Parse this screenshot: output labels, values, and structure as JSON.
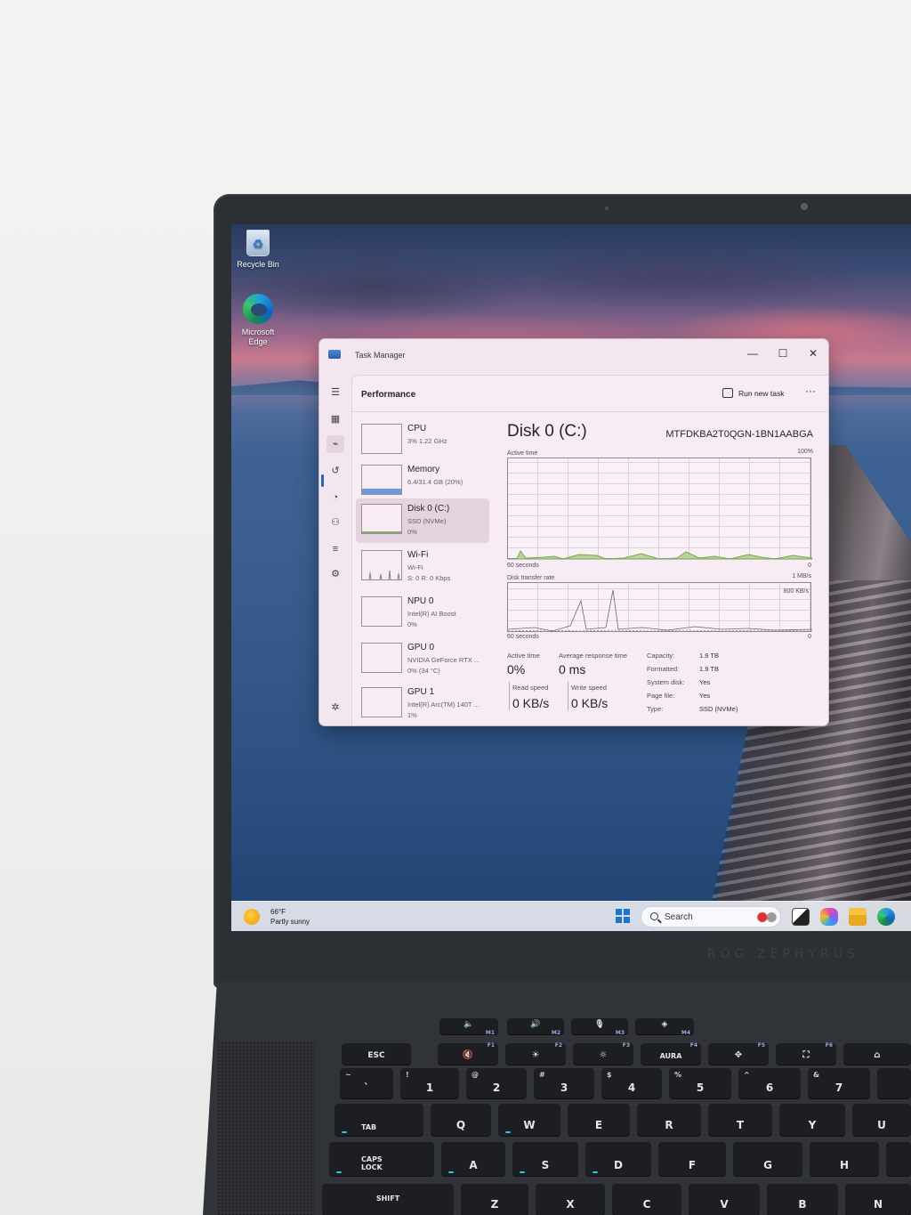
{
  "desktop": {
    "icons": [
      {
        "label": "Recycle Bin",
        "icon": "recycle-bin-icon"
      },
      {
        "label": "Microsoft Edge",
        "icon": "edge-icon"
      }
    ]
  },
  "window": {
    "title": "Task Manager",
    "controls": {
      "minimize": "—",
      "maximize": "☐",
      "close": "✕"
    }
  },
  "header": {
    "section_title": "Performance",
    "run_new_task": "Run new task",
    "more": "···"
  },
  "rail": {
    "icons": [
      "hamburger-icon",
      "processes-icon",
      "performance-icon",
      "app-history-icon",
      "startup-icon",
      "users-icon",
      "details-icon",
      "services-icon",
      "settings-icon"
    ]
  },
  "devices": [
    {
      "name": "CPU",
      "line1": "3%  1.22 GHz",
      "line2": ""
    },
    {
      "name": "Memory",
      "line1": "6.4/31.4 GB (20%)",
      "line2": ""
    },
    {
      "name": "Disk 0 (C:)",
      "line1": "SSD (NVMe)",
      "line2": "0%"
    },
    {
      "name": "Wi-Fi",
      "line1": "Wi-Fi",
      "line2": "S: 0  R: 0 Kbps"
    },
    {
      "name": "NPU 0",
      "line1": "Intel(R) AI Boost",
      "line2": "0%"
    },
    {
      "name": "GPU 0",
      "line1": "NVIDIA GeForce RTX ...",
      "line2": "0%  (34 °C)"
    },
    {
      "name": "GPU 1",
      "line1": "Intel(R) Arc(TM) 140T ...",
      "line2": "1%"
    }
  ],
  "selected_device": 2,
  "detail": {
    "title": "Disk 0 (C:)",
    "model": "MTFDKBA2T0QGN-1BN1AABGA",
    "graph1": {
      "label": "Active time",
      "max": "100%",
      "time": "60 seconds",
      "min": "0"
    },
    "graph2": {
      "label": "Disk transfer rate",
      "max": "1 MB/s",
      "mid": "800 KB/s",
      "time": "60 seconds",
      "min": "0"
    },
    "stats": {
      "active_time_label": "Active time",
      "active_time_value": "0%",
      "avg_response_label": "Average response time",
      "avg_response_value": "0 ms",
      "read_label": "Read speed",
      "read_value": "0 KB/s",
      "write_label": "Write speed",
      "write_value": "0 KB/s"
    },
    "properties": [
      {
        "key": "Capacity:",
        "value": "1.9 TB"
      },
      {
        "key": "Formatted:",
        "value": "1.9 TB"
      },
      {
        "key": "System disk:",
        "value": "Yes"
      },
      {
        "key": "Page file:",
        "value": "Yes"
      },
      {
        "key": "Type:",
        "value": "SSD (NVMe)"
      }
    ]
  },
  "taskbar": {
    "weather_temp": "66°F",
    "weather_desc": "Partly sunny",
    "search_label": "Search",
    "apps": [
      "task-view-icon",
      "copilot-icon",
      "file-explorer-icon",
      "edge-icon"
    ]
  },
  "keyboard": {
    "media_keys": [
      "M1",
      "M2",
      "M3",
      "M4"
    ],
    "row_fn": [
      {
        "main": "ESC",
        "fn": ""
      },
      {
        "main": "",
        "fn": "F1"
      },
      {
        "main": "",
        "fn": "F2"
      },
      {
        "main": "",
        "fn": "F3"
      },
      {
        "main": "AURA",
        "fn": "F4"
      },
      {
        "main": "",
        "fn": "F5"
      },
      {
        "main": "",
        "fn": "F6"
      },
      {
        "main": "",
        "fn": ""
      }
    ],
    "row_num": [
      {
        "sub": "~",
        "main": "`"
      },
      {
        "sub": "!",
        "main": "1"
      },
      {
        "sub": "@",
        "main": "2"
      },
      {
        "sub": "#",
        "main": "3"
      },
      {
        "sub": "$",
        "main": "4"
      },
      {
        "sub": "%",
        "main": "5"
      },
      {
        "sub": "^",
        "main": "6"
      },
      {
        "sub": "&",
        "main": "7"
      },
      {
        "sub": "",
        "main": ""
      }
    ],
    "row_q": [
      "TAB",
      "Q",
      "W",
      "E",
      "R",
      "T",
      "Y",
      "U"
    ],
    "row_a": [
      "CAPS LOCK",
      "A",
      "S",
      "D",
      "F",
      "G",
      "H",
      ""
    ],
    "row_z": [
      "SHIFT",
      "Z",
      "X",
      "C",
      "V",
      "B",
      "N"
    ]
  },
  "colors": {
    "accent": "#2a62c0",
    "window_bg": "#f2e6ef",
    "disk_graph_fill": "#b8d49a",
    "memory_fill": "#6a9ae0",
    "keyboard_glow": "#2fc6e0"
  }
}
